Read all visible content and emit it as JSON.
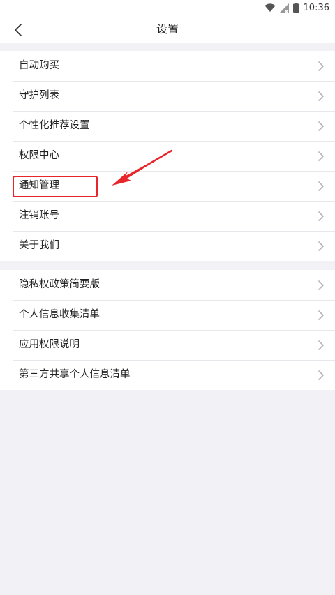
{
  "status_bar": {
    "time": "10:36",
    "icons": [
      "wifi-icon",
      "signal-icon",
      "battery-icon"
    ]
  },
  "header": {
    "back_icon": "chevron-left-icon",
    "title": "设置"
  },
  "settings_group_1": [
    {
      "label": "自动购买"
    },
    {
      "label": "守护列表"
    },
    {
      "label": "个性化推荐设置"
    },
    {
      "label": "权限中心"
    },
    {
      "label": "通知管理"
    },
    {
      "label": "注销账号"
    },
    {
      "label": "关于我们"
    }
  ],
  "settings_group_2": [
    {
      "label": "隐私权政策简要版"
    },
    {
      "label": "个人信息收集清单"
    },
    {
      "label": "应用权限说明"
    },
    {
      "label": "第三方共享个人信息清单"
    }
  ],
  "annotation": {
    "highlight_color": "#e8252a"
  }
}
